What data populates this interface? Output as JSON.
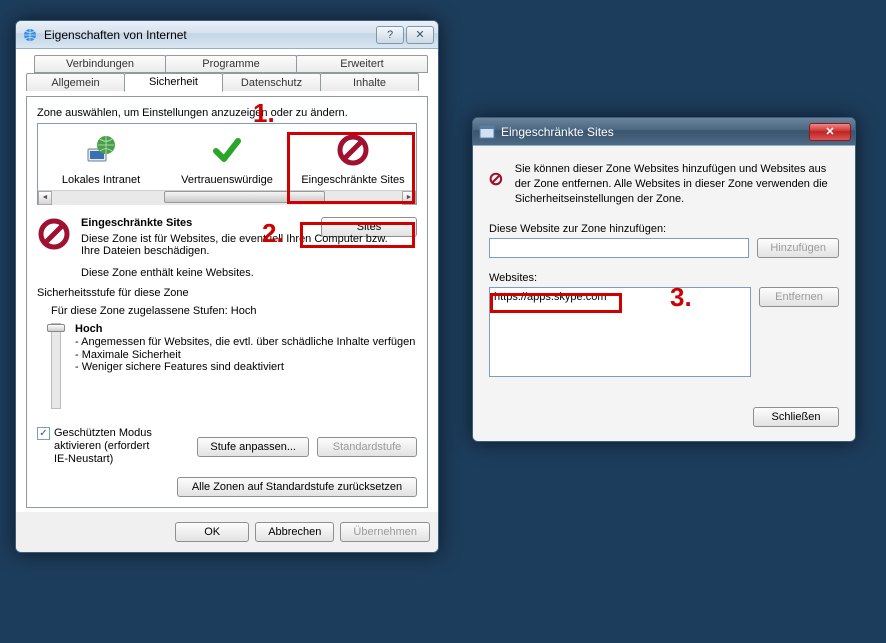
{
  "colors": {
    "anno": "#d10000"
  },
  "annotations": {
    "n1": "1.",
    "n2": "2.",
    "n3": "3."
  },
  "dlg1": {
    "title": "Eigenschaften von Internet",
    "tabs_top": [
      "Verbindungen",
      "Programme",
      "Erweitert"
    ],
    "tabs_bottom": [
      "Allgemein",
      "Sicherheit",
      "Datenschutz",
      "Inhalte"
    ],
    "zone_prompt": "Zone auswählen, um Einstellungen anzuzeigen oder zu ändern.",
    "zones": {
      "z0": "Lokales Intranet",
      "z1": "Vertrauenswürdige",
      "z2": "Eingeschränkte Sites"
    },
    "sel_title": "Eingeschränkte Sites",
    "sel_desc1": "Diese Zone ist für Websites, die eventuell Ihren Computer bzw.",
    "sel_desc2": "Ihre Dateien beschädigen.",
    "empty_note": "Diese Zone enthält keine Websites.",
    "sites_btn": "Sites",
    "sec_level_label": "Sicherheitsstufe für diese Zone",
    "allowed_levels": "Für diese Zone zugelassene Stufen: Hoch",
    "level": {
      "name": "Hoch",
      "b1": "- Angemessen für Websites, die evtl. über schädliche Inhalte verfügen",
      "b2": "- Maximale Sicherheit",
      "b3": "- Weniger sichere Features sind deaktiviert"
    },
    "protected_mode1": "Geschützten Modus",
    "protected_mode2": "aktivieren (erfordert",
    "protected_mode3": "IE-Neustart)",
    "btn_custom": "Stufe anpassen...",
    "btn_default": "Standardstufe",
    "btn_reset_all": "Alle Zonen auf Standardstufe zurücksetzen",
    "btn_ok": "OK",
    "btn_cancel": "Abbrechen",
    "btn_apply": "Übernehmen"
  },
  "dlg2": {
    "title": "Eingeschränkte Sites",
    "desc": "Sie können dieser Zone Websites hinzufügen und Websites aus der Zone entfernen. Alle Websites in dieser Zone verwenden die Sicherheitseinstellungen der Zone.",
    "add_label": "Diese Website zur Zone hinzufügen:",
    "add_value": "",
    "btn_add": "Hinzufügen",
    "list_label": "Websites:",
    "list_item": "https://apps.skype.com",
    "btn_remove": "Entfernen",
    "btn_close": "Schließen"
  }
}
